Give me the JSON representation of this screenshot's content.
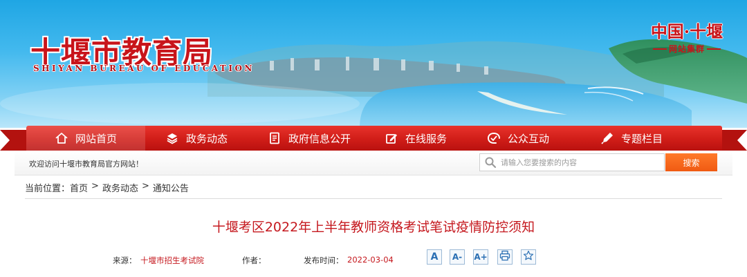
{
  "header": {
    "site_title": "十堰市教育局",
    "site_subtitle": "SHIYAN BUREAU OF EDUCATION",
    "group_logo_main": "中国·十堰",
    "group_logo_sub": "网站集群"
  },
  "nav": {
    "items": [
      {
        "label": "网站首页",
        "icon": "home-icon"
      },
      {
        "label": "政务动态",
        "icon": "layers-icon"
      },
      {
        "label": "政府信息公开",
        "icon": "document-icon"
      },
      {
        "label": "在线服务",
        "icon": "edit-icon"
      },
      {
        "label": "公众互动",
        "icon": "chat-icon"
      },
      {
        "label": "专题栏目",
        "icon": "pen-icon"
      }
    ]
  },
  "welcome": {
    "text": "欢迎访问十堰市教育局官方网站！"
  },
  "search": {
    "placeholder": "请输入您要搜索的内容",
    "button_label": "搜索"
  },
  "breadcrumb": {
    "prefix": "当前位置：",
    "items": [
      "首页",
      "政务动态",
      "通知公告"
    ],
    "separator": ">"
  },
  "article": {
    "title": "十堰考区2022年上半年教师资格考试笔试疫情防控须知",
    "source_label": "来源：",
    "source": "十堰市招生考试院",
    "author_label": "作者：",
    "date_label": "发布时间：",
    "date": "2022-03-04"
  },
  "tools": [
    {
      "label": "A",
      "icon": "font-default-icon"
    },
    {
      "label": "A-",
      "icon": "font-decrease-icon"
    },
    {
      "label": "A+",
      "icon": "font-increase-icon"
    },
    {
      "label": "",
      "icon": "print-icon"
    },
    {
      "label": "",
      "icon": "star-icon"
    }
  ],
  "colors": {
    "brand_red": "#c8141a",
    "nav_red": "#d01d18",
    "search_orange": "#f05a12",
    "sky_blue": "#1fa6e4"
  }
}
